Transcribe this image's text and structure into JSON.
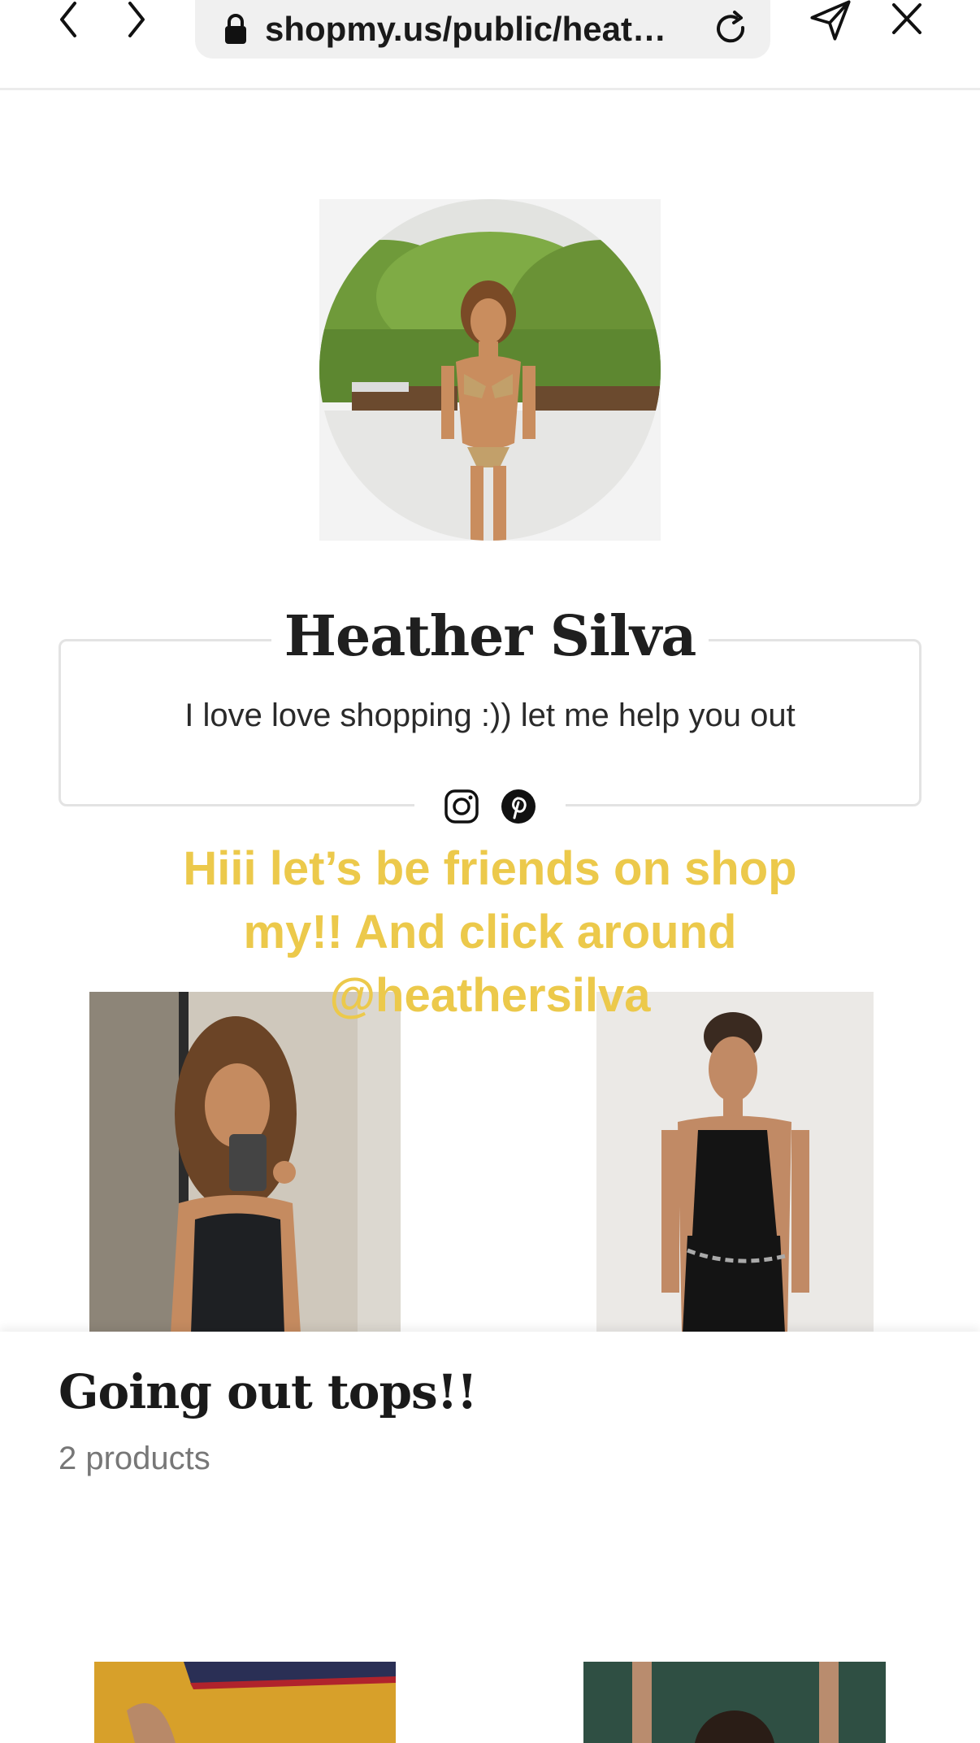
{
  "browser": {
    "url": "shopmy.us/public/heat…",
    "icons": {
      "back": "chevron-left-icon",
      "forward": "chevron-right-icon",
      "lock": "lock-icon",
      "reload": "reload-icon",
      "share": "send-icon",
      "close": "close-icon"
    }
  },
  "profile": {
    "name": "Heather Silva",
    "bio": "I love love shopping :)) let me help you out",
    "socials": [
      "instagram-icon",
      "pinterest-icon"
    ]
  },
  "promo": {
    "text": "Hiii let’s be friends on shop my!! And click around @heathersilva",
    "color": "#ECC94B"
  },
  "collection": {
    "title": "Going out tops!!",
    "count": "2 products"
  }
}
